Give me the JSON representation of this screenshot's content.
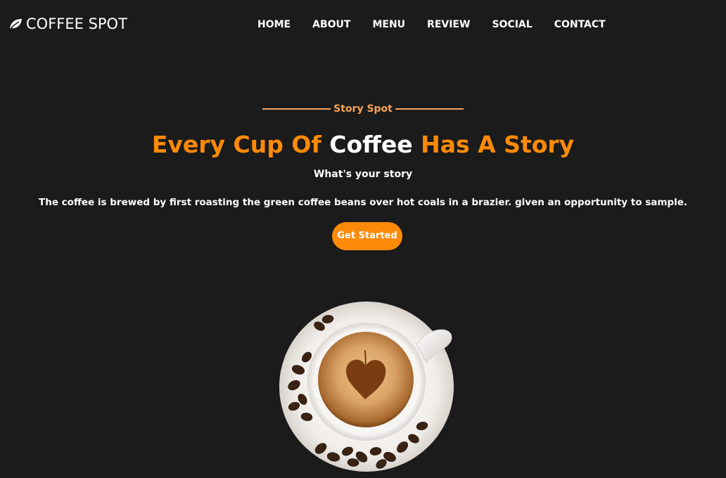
{
  "header": {
    "logo_text": "COFFEE SPOT",
    "logo_icon": "leaf-icon",
    "nav": [
      {
        "label": "HOME"
      },
      {
        "label": "ABOUT"
      },
      {
        "label": "MENU"
      },
      {
        "label": "REVIEW"
      },
      {
        "label": "SOCIAL"
      },
      {
        "label": "CONTACT"
      }
    ]
  },
  "hero": {
    "eyebrow": "Story Spot",
    "headline": {
      "part1": "Every Cup Of ",
      "highlight": "Coffee",
      "part2": " Has A Story"
    },
    "subheading": "What's your story",
    "description": "The coffee is brewed by first roasting the green coffee beans over hot coals in a brazier. given an opportunity to sample.",
    "cta_label": "Get Started",
    "image": "coffee-cup-heart-latte-art"
  },
  "colors": {
    "background": "#1b1b1b",
    "accent": "#ff8a08",
    "eyebrow": "#f7a25a",
    "text": "#ffffff"
  }
}
